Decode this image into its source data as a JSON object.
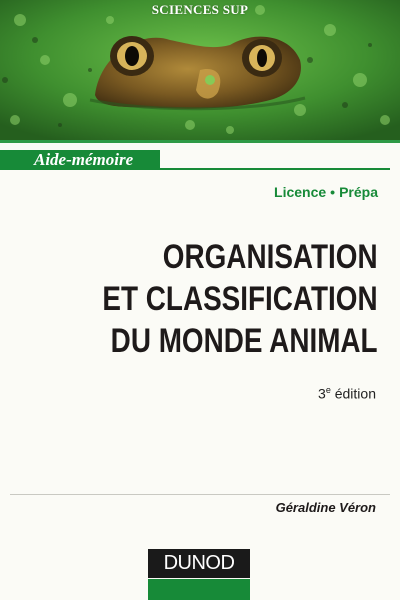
{
  "cover": {
    "series": "SCIENCES SUP",
    "collection": "Aide-mémoire",
    "level": {
      "first": "Licence",
      "separator": "•",
      "second": "Prépa"
    },
    "title_lines": [
      "ORGANISATION",
      "ET CLASSIFICATION",
      "DU MONDE ANIMAL"
    ],
    "edition": {
      "number": "3",
      "suffix": "e",
      "label": "édition"
    },
    "author": "Géraldine Véron",
    "publisher": "DUNOD"
  },
  "colors": {
    "brand_green": "#178a38",
    "title_text": "#1e1a1a",
    "background": "#fbfbf6"
  },
  "icons": {
    "photo": "frog-in-pond-photo"
  }
}
